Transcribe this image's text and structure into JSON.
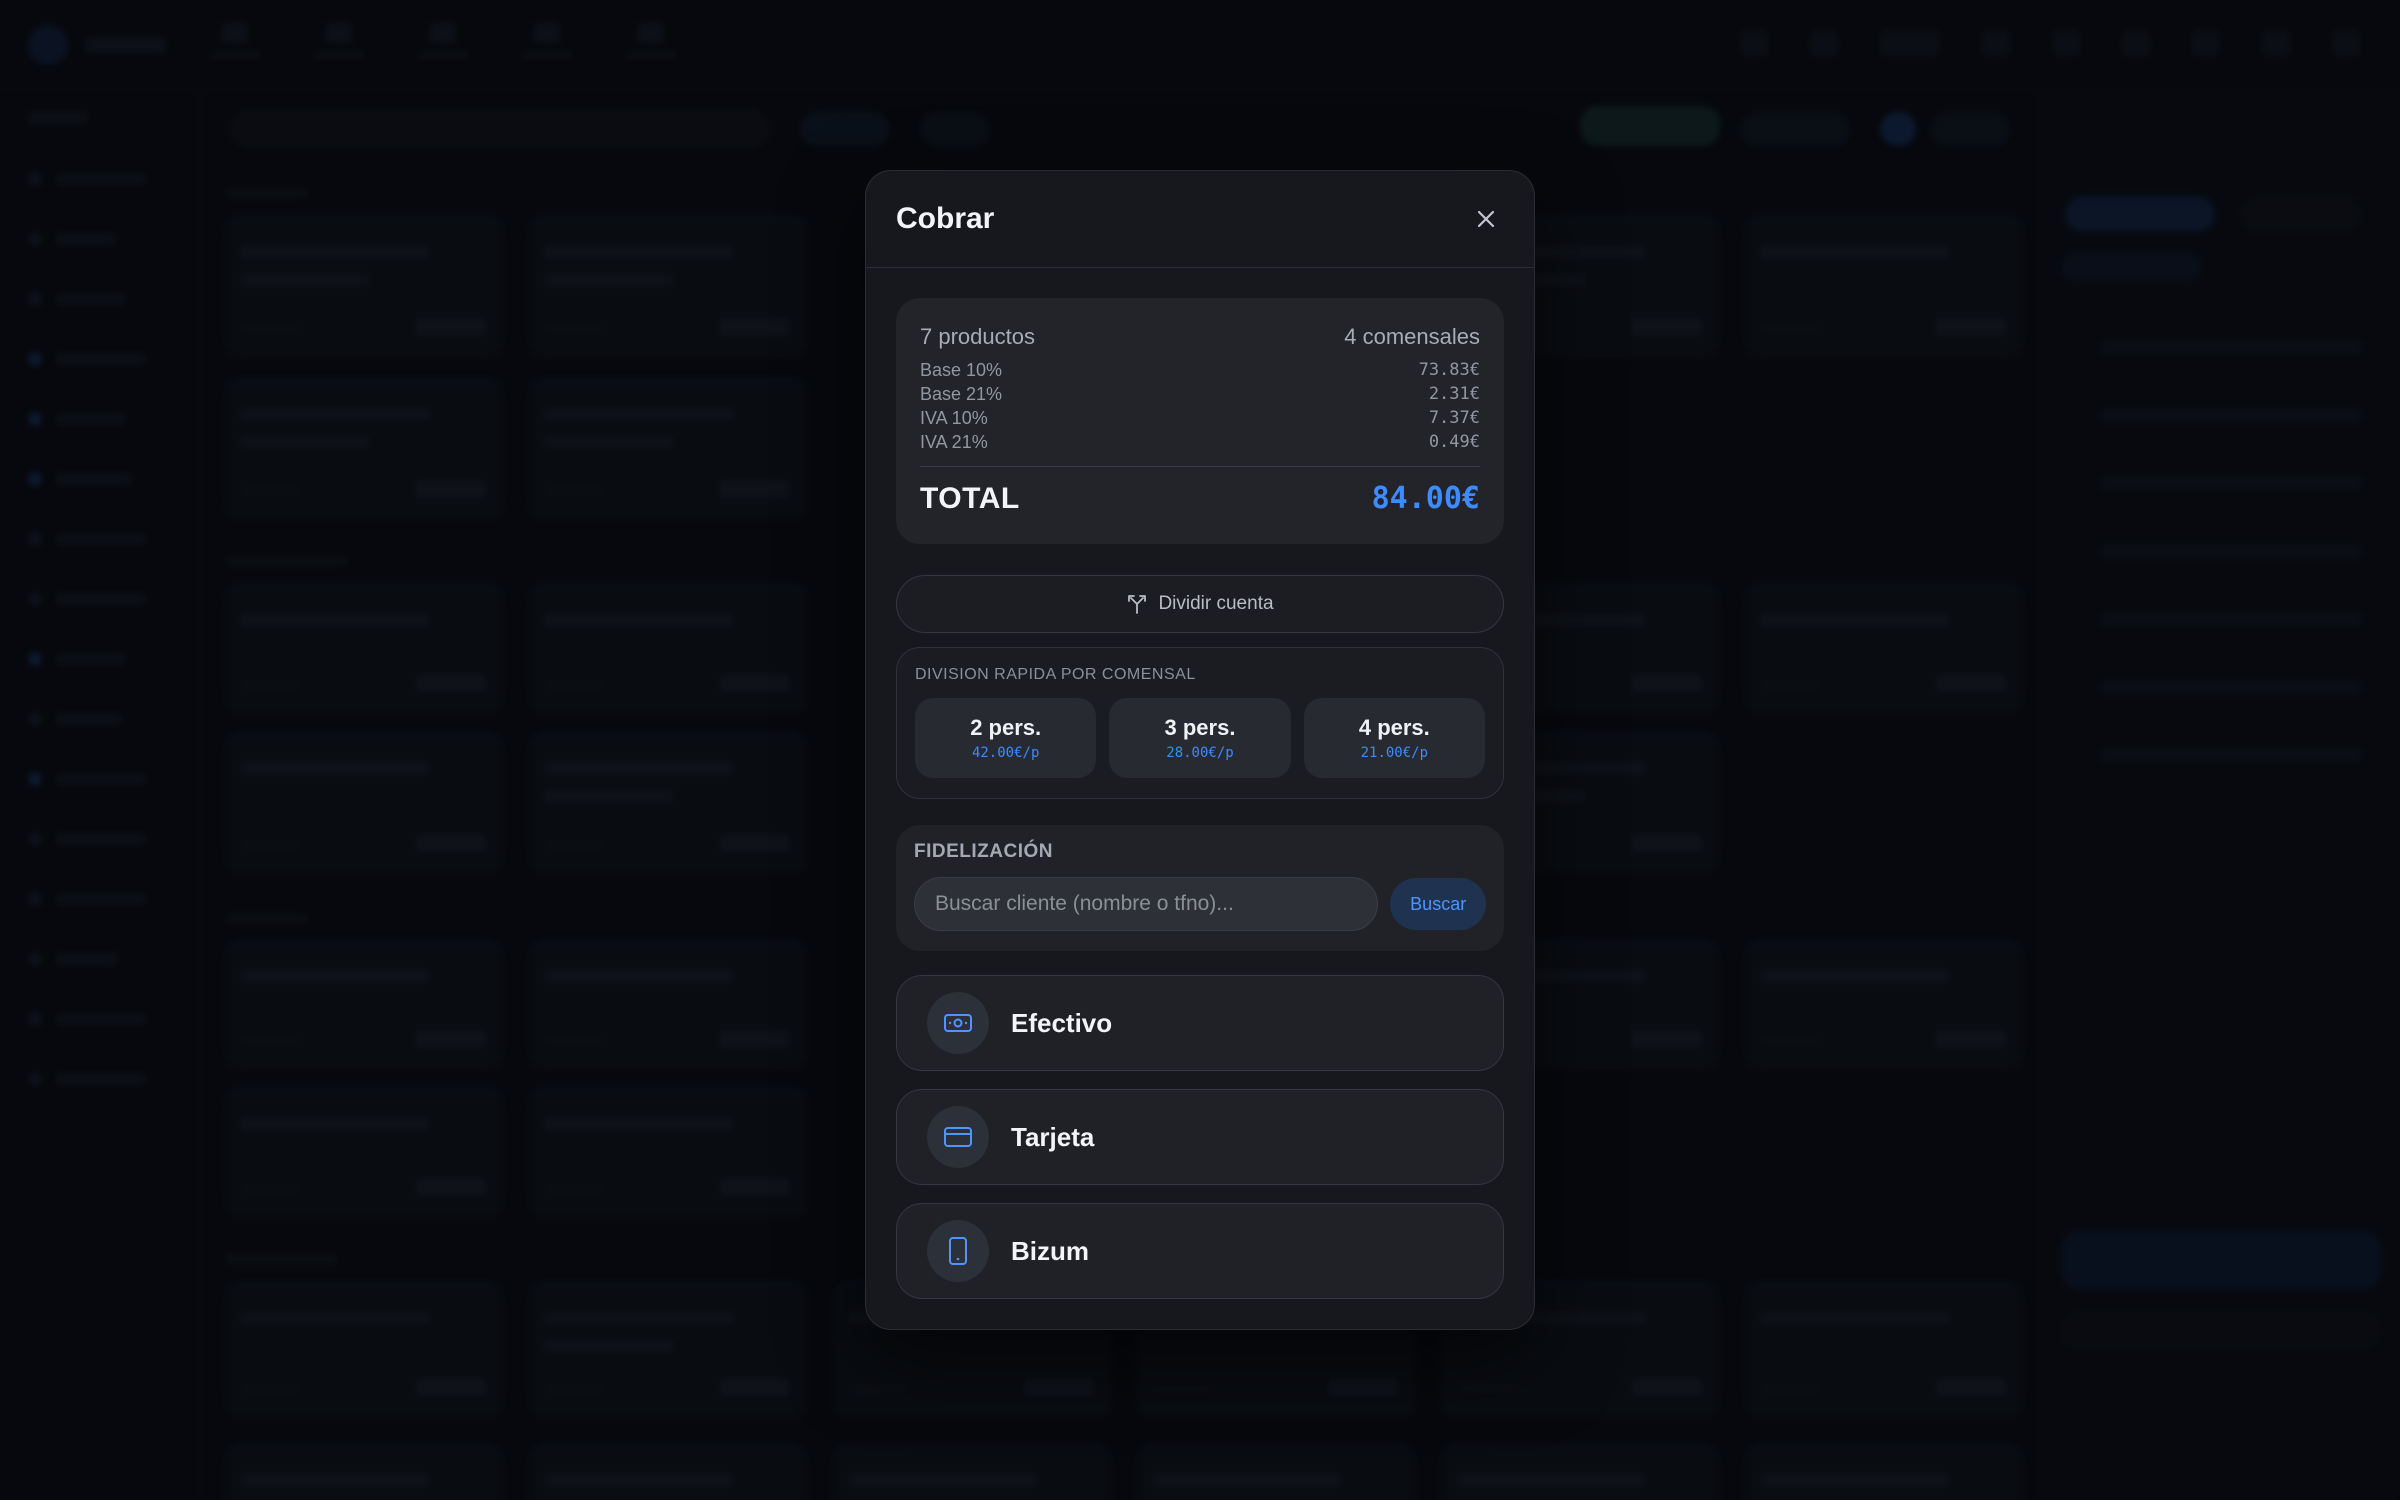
{
  "modal": {
    "title": "Cobrar",
    "summary": {
      "products": "7 productos",
      "diners": "4 comensales",
      "tax_lines": [
        {
          "label": "Base 10%",
          "value": "73.83€"
        },
        {
          "label": "Base 21%",
          "value": "2.31€"
        },
        {
          "label": "IVA 10%",
          "value": "7.37€"
        },
        {
          "label": "IVA 21%",
          "value": "0.49€"
        }
      ],
      "total_label": "TOTAL",
      "total_value": "84.00€"
    },
    "split_button_label": "Dividir cuenta",
    "quick_split": {
      "title": "DIVISION RAPIDA POR COMENSAL",
      "options": [
        {
          "label": "2 pers.",
          "per_person": "42.00€/p"
        },
        {
          "label": "3 pers.",
          "per_person": "28.00€/p"
        },
        {
          "label": "4 pers.",
          "per_person": "21.00€/p"
        }
      ]
    },
    "loyalty": {
      "title": "FIDELIZACIÓN",
      "search_placeholder": "Buscar cliente (nombre o tfno)...",
      "search_value": "",
      "search_button": "Buscar"
    },
    "payment_methods": [
      {
        "label": "Efectivo",
        "icon": "cash-icon"
      },
      {
        "label": "Tarjeta",
        "icon": "credit-card-icon"
      },
      {
        "label": "Bizum",
        "icon": "mobile-phone-icon"
      }
    ]
  },
  "colors": {
    "accent": "#3d8bff",
    "modal_bg": "#16181e",
    "overlay": "#04060a"
  }
}
